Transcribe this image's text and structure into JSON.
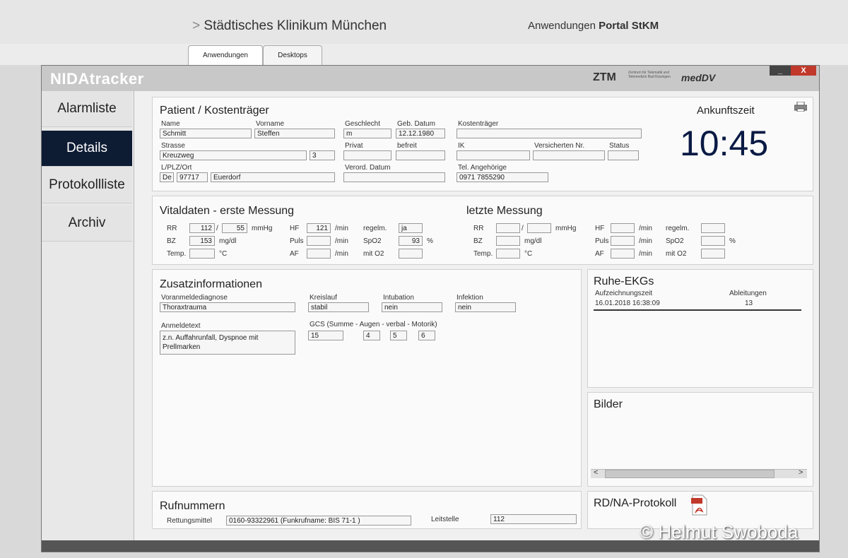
{
  "portal": {
    "arrow": ">",
    "title": "Städtisches Klinikum München",
    "right_prefix": "Anwendungen",
    "right_bold": "Portal StKM",
    "tabs": [
      "Anwendungen",
      "Desktops"
    ]
  },
  "app": {
    "name": "NIDAtracker",
    "logo_ztm": "ZTM",
    "logo_ztm_sub": "Zentrum für Telematik und Telemedizin Bad Kissingen",
    "logo_meddv": "medDV",
    "minimize": "_",
    "close": "X"
  },
  "sidebar": [
    "Alarmliste",
    "Details",
    "Protokollliste",
    "Archiv"
  ],
  "patient": {
    "title": "Patient / Kostenträger",
    "labels": {
      "name": "Name",
      "vorname": "Vorname",
      "geschlecht": "Geschlecht",
      "geb": "Geb. Datum",
      "kostentraeger": "Kostenträger",
      "strasse": "Strasse",
      "privat": "Privat",
      "befreit": "befreit",
      "ik": "IK",
      "versnr": "Versicherten Nr.",
      "status": "Status",
      "lplz": "L/PLZ/Ort",
      "verord": "Verord. Datum",
      "tel": "Tel. Angehörige"
    },
    "values": {
      "name": "Schmitt",
      "vorname": "Steffen",
      "geschlecht": "m",
      "geb": "12.12.1980",
      "strasse": "Kreuzweg",
      "hausnr": "3",
      "land": "De",
      "plz": "97717",
      "ort": "Euerdorf",
      "tel": "0971 7855290"
    }
  },
  "arrival": {
    "label": "Ankunftszeit",
    "time": "10:45",
    "print_icon": "printer-icon"
  },
  "vital_first": {
    "title": "Vitaldaten - erste Messung",
    "labels": {
      "rr": "RR",
      "sep": "/",
      "mmhg": "mmHg",
      "bz": "BZ",
      "mgdl": "mg/dl",
      "temp": "Temp.",
      "c": "°C",
      "hf": "HF",
      "min": "/min",
      "puls": "Puls",
      "af": "AF",
      "regelm": "regelm.",
      "spo2": "SpO2",
      "pct": "%",
      "mito2": "mit O2"
    },
    "values": {
      "rr_sys": "112",
      "rr_dia": "55",
      "bz": "153",
      "hf": "121",
      "regelm": "ja",
      "spo2": "93"
    }
  },
  "vital_last": {
    "title": "letzte Messung"
  },
  "zusatz": {
    "title": "Zusatzinformationen",
    "labels": {
      "diag": "Voranmeldediagnose",
      "kreislauf": "Kreislauf",
      "intubation": "Intubation",
      "infektion": "Infektion",
      "anmeldetext": "Anmeldetext",
      "gcs": "GCS (Summe - Augen - verbal - Motorik)"
    },
    "values": {
      "diag": "Thoraxtrauma",
      "kreislauf": "stabil",
      "intubation": "nein",
      "infektion": "nein",
      "anmeldetext": "z.n. Auffahrunfall, Dyspnoe mit Prellmarken",
      "gcs_sum": "15",
      "gcs_augen": "4",
      "gcs_verbal": "5",
      "gcs_motorik": "6"
    }
  },
  "ekg": {
    "title": "Ruhe-EKGs",
    "col_time": "Aufzeichnungszeit",
    "col_leads": "Ableitungen",
    "rows": [
      {
        "time": "16.01.2018 16:38:09",
        "leads": "13"
      }
    ]
  },
  "bilder": {
    "title": "Bilder",
    "left": "<",
    "right": ">"
  },
  "rufnummern": {
    "title": "Rufnummern",
    "rettung_label": "Rettungsmittel",
    "rettung_value": "0160-93322961 (Funkrufname: BIS 71-1 )",
    "leitstelle_label": "Leitstelle",
    "leitstelle_value": "112"
  },
  "protokoll": {
    "title": "RD/NA-Protokoll",
    "icon": "pdf-icon"
  },
  "watermark": "© Helmut Swoboda"
}
